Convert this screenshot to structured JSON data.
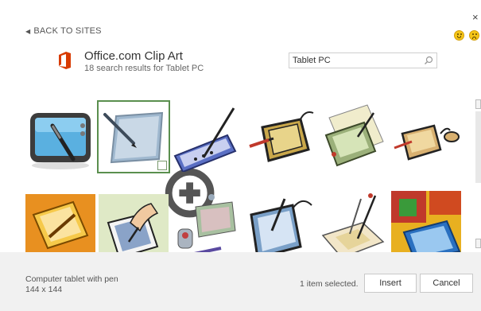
{
  "nav": {
    "back_label": "BACK TO SITES",
    "close_glyph": "×"
  },
  "feedback": {
    "happy": "smile-icon",
    "sad": "frown-icon"
  },
  "header": {
    "title": "Office.com Clip Art",
    "subtitle": "18 search results for Tablet PC",
    "logo_color": "#d83b01"
  },
  "search": {
    "value": "Tablet PC",
    "placeholder": ""
  },
  "results": [
    {
      "icon": "tablet-screen-pen-icon"
    },
    {
      "icon": "tablet-with-pen-icon",
      "selected": true
    },
    {
      "icon": "stylus-pad-icon"
    },
    {
      "icon": "drawing-tablet-cartoon-icon"
    },
    {
      "icon": "tablet-on-paper-icon"
    },
    {
      "icon": "tablet-and-mouse-icon"
    },
    {
      "icon": "hand-writing-tablet-icon"
    },
    {
      "icon": "hand-pen-tablet-icon"
    },
    {
      "icon": "tablet-and-drive-icon"
    },
    {
      "icon": "tablet-cable-pen-icon"
    },
    {
      "icon": "pen-drawing-tablet-icon"
    },
    {
      "icon": "colorful-blocks-icon"
    }
  ],
  "footer": {
    "description": "Computer tablet with pen",
    "dimensions": "144 x 144",
    "status": "1 item selected.",
    "insert_label": "Insert",
    "cancel_label": "Cancel"
  },
  "colors": {
    "selection": "#5a8f4e",
    "footer_bg": "#f1f1f1"
  }
}
